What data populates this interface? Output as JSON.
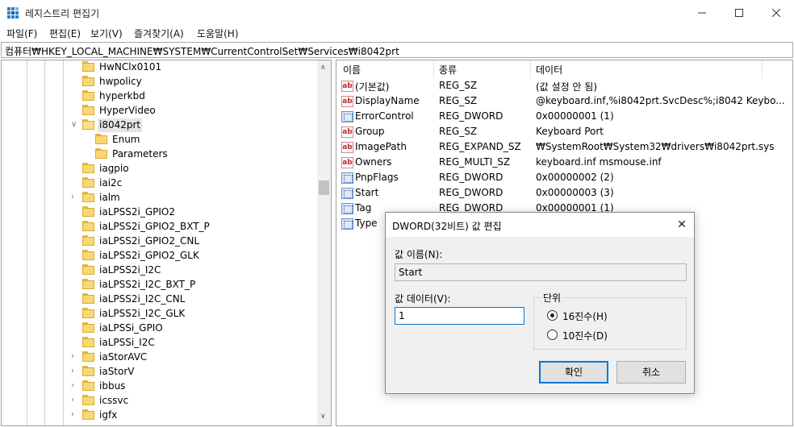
{
  "window": {
    "title": "레지스트리 편집기",
    "accent_color": "#0078d7"
  },
  "menu": [
    "파일(F)",
    "편집(E)",
    "보기(V)",
    "즐겨찾기(A)",
    "도움말(H)"
  ],
  "address": "컴퓨터₩HKEY_LOCAL_MACHINE₩SYSTEM₩CurrentControlSet₩Services₩i8042prt",
  "tree": [
    {
      "label": "HwNClx0101",
      "level": 0,
      "expander": "none",
      "selected": false
    },
    {
      "label": "hwpolicy",
      "level": 0,
      "expander": "none",
      "selected": false
    },
    {
      "label": "hyperkbd",
      "level": 0,
      "expander": "none",
      "selected": false
    },
    {
      "label": "HyperVideo",
      "level": 0,
      "expander": "none",
      "selected": false
    },
    {
      "label": "i8042prt",
      "level": 0,
      "expander": "expanded",
      "selected": true
    },
    {
      "label": "Enum",
      "level": 1,
      "expander": "none",
      "selected": false
    },
    {
      "label": "Parameters",
      "level": 1,
      "expander": "none",
      "selected": false
    },
    {
      "label": "iagpio",
      "level": 0,
      "expander": "none",
      "selected": false
    },
    {
      "label": "iai2c",
      "level": 0,
      "expander": "none",
      "selected": false
    },
    {
      "label": "ialm",
      "level": 0,
      "expander": "collapsed",
      "selected": false
    },
    {
      "label": "iaLPSS2i_GPIO2",
      "level": 0,
      "expander": "none",
      "selected": false
    },
    {
      "label": "iaLPSS2i_GPIO2_BXT_P",
      "level": 0,
      "expander": "none",
      "selected": false
    },
    {
      "label": "iaLPSS2i_GPIO2_CNL",
      "level": 0,
      "expander": "none",
      "selected": false
    },
    {
      "label": "iaLPSS2i_GPIO2_GLK",
      "level": 0,
      "expander": "none",
      "selected": false
    },
    {
      "label": "iaLPSS2i_I2C",
      "level": 0,
      "expander": "none",
      "selected": false
    },
    {
      "label": "iaLPSS2i_I2C_BXT_P",
      "level": 0,
      "expander": "none",
      "selected": false
    },
    {
      "label": "iaLPSS2i_I2C_CNL",
      "level": 0,
      "expander": "none",
      "selected": false
    },
    {
      "label": "iaLPSS2i_I2C_GLK",
      "level": 0,
      "expander": "none",
      "selected": false
    },
    {
      "label": "iaLPSSi_GPIO",
      "level": 0,
      "expander": "none",
      "selected": false
    },
    {
      "label": "iaLPSSi_I2C",
      "level": 0,
      "expander": "none",
      "selected": false
    },
    {
      "label": "iaStorAVC",
      "level": 0,
      "expander": "collapsed",
      "selected": false
    },
    {
      "label": "iaStorV",
      "level": 0,
      "expander": "collapsed",
      "selected": false
    },
    {
      "label": "ibbus",
      "level": 0,
      "expander": "collapsed",
      "selected": false
    },
    {
      "label": "icssvc",
      "level": 0,
      "expander": "collapsed",
      "selected": false
    },
    {
      "label": "igfx",
      "level": 0,
      "expander": "collapsed",
      "selected": false
    }
  ],
  "list": {
    "columns": [
      "이름",
      "종류",
      "데이터"
    ],
    "rows": [
      {
        "name": "(기본값)",
        "type": "REG_SZ",
        "data": "(값 설정 안 됨)",
        "icon": "string-value-icon"
      },
      {
        "name": "DisplayName",
        "type": "REG_SZ",
        "data": "@keyboard.inf,%i8042prt.SvcDesc%;i8042 Keybo...",
        "icon": "string-value-icon"
      },
      {
        "name": "ErrorControl",
        "type": "REG_DWORD",
        "data": "0x00000001 (1)",
        "icon": "binary-value-icon"
      },
      {
        "name": "Group",
        "type": "REG_SZ",
        "data": "Keyboard Port",
        "icon": "string-value-icon"
      },
      {
        "name": "ImagePath",
        "type": "REG_EXPAND_SZ",
        "data": "₩SystemRoot₩System32₩drivers₩i8042prt.sys",
        "icon": "string-value-icon"
      },
      {
        "name": "Owners",
        "type": "REG_MULTI_SZ",
        "data": "keyboard.inf msmouse.inf",
        "icon": "string-value-icon"
      },
      {
        "name": "PnpFlags",
        "type": "REG_DWORD",
        "data": "0x00000002 (2)",
        "icon": "binary-value-icon"
      },
      {
        "name": "Start",
        "type": "REG_DWORD",
        "data": "0x00000003 (3)",
        "icon": "binary-value-icon"
      },
      {
        "name": "Tag",
        "type": "REG_DWORD",
        "data": "0x00000001 (1)",
        "icon": "binary-value-icon"
      },
      {
        "name": "Type",
        "type": "",
        "data": "",
        "icon": "binary-value-icon"
      }
    ]
  },
  "dialog": {
    "title": "DWORD(32비트) 값 편집",
    "value_name_label": "값 이름(N):",
    "value_name": "Start",
    "value_data_label": "값 데이터(V):",
    "value_data": "1",
    "base_label": "단위",
    "hex_label": "16진수(H)",
    "dec_label": "10진수(D)",
    "selected_base": "hex",
    "ok_label": "확인",
    "cancel_label": "취소"
  }
}
